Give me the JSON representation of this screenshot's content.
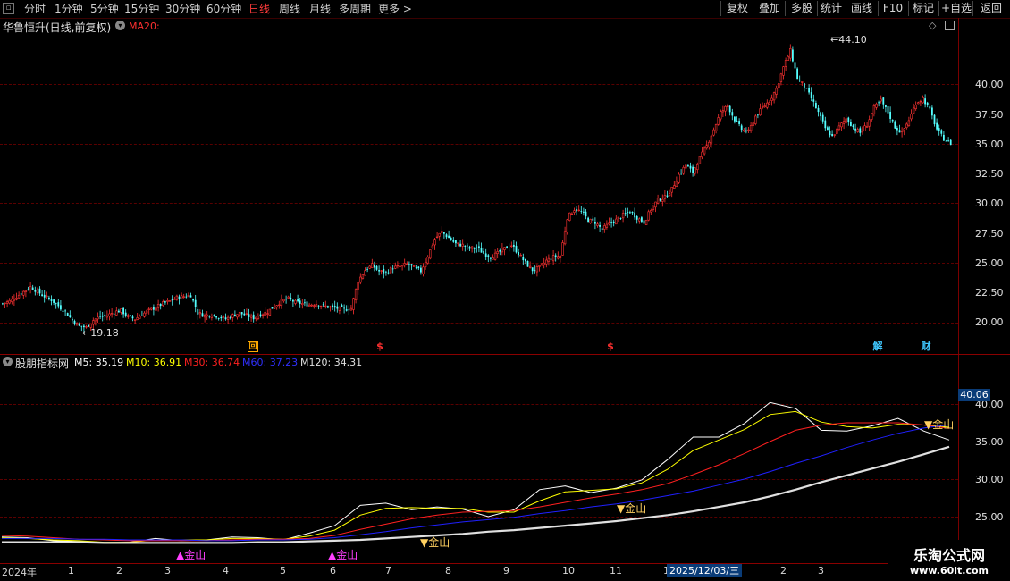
{
  "toolbar": {
    "items": [
      "分时",
      "1分钟",
      "5分钟",
      "15分钟",
      "30分钟",
      "60分钟",
      "日线",
      "周线",
      "月线",
      "多周期",
      "更多 >"
    ],
    "active_index": 6,
    "right_buttons": [
      "复权",
      "叠加",
      "多股",
      "统计",
      "画线",
      "F10",
      "标记",
      "+自选",
      "返回"
    ]
  },
  "main_panel": {
    "stock_title": "华鲁恒升(日线,前复权)",
    "ma_label": "MA20:",
    "high_label": "44.10",
    "low_label": "19.18",
    "markers": [
      "回",
      "$",
      "$",
      "解",
      "财"
    ],
    "ma_color": "#ff3030"
  },
  "indicator": {
    "name": "股朋指标网",
    "m5": "M5: 35.19",
    "m10": "M10: 36.91",
    "m30": "M30: 36.74",
    "m60": "M60: 37.23",
    "m120": "M120: 34.31",
    "current_value": "40.06",
    "signals": [
      "金山",
      "金山",
      "金山",
      "金山",
      "金山",
      "金山"
    ]
  },
  "axes": {
    "main_prices": [
      "40.00",
      "37.50",
      "35.00",
      "32.50",
      "30.00",
      "27.50",
      "25.00",
      "22.50",
      "20.00"
    ],
    "indicator_prices": [
      "40.00",
      "35.00",
      "30.00",
      "25.00"
    ],
    "x_labels": [
      "2024年",
      "1",
      "2",
      "3",
      "4",
      "5",
      "6",
      "7",
      "8",
      "9",
      "10",
      "11",
      "1",
      "2",
      "3"
    ],
    "cursor_date": "2025/12/03/三"
  },
  "watermark": {
    "title": "乐淘公式网",
    "url": "www.60lt.com"
  },
  "chart_data": {
    "type": "candlestick",
    "title": "",
    "ylim": [
      18,
      45
    ],
    "high": 44.1,
    "low": 19.18,
    "close_path": [
      [
        0,
        21.6
      ],
      [
        3,
        21.8
      ],
      [
        6,
        22.2
      ],
      [
        9,
        22.6
      ],
      [
        12,
        23.0
      ],
      [
        15,
        22.6
      ],
      [
        18,
        22.2
      ],
      [
        21,
        21.9
      ],
      [
        24,
        21.4
      ],
      [
        27,
        20.9
      ],
      [
        30,
        20.2
      ],
      [
        33,
        19.7
      ],
      [
        36,
        19.6
      ],
      [
        39,
        20.2
      ],
      [
        42,
        20.5
      ],
      [
        45,
        20.6
      ],
      [
        48,
        20.9
      ],
      [
        51,
        21.0
      ],
      [
        54,
        20.5
      ],
      [
        57,
        20.3
      ],
      [
        60,
        20.7
      ],
      [
        63,
        21.0
      ],
      [
        66,
        21.3
      ],
      [
        69,
        21.6
      ],
      [
        72,
        21.8
      ],
      [
        75,
        22.1
      ],
      [
        78,
        22.2
      ],
      [
        81,
        22.3
      ],
      [
        84,
        20.8
      ],
      [
        87,
        20.6
      ],
      [
        90,
        20.7
      ],
      [
        93,
        20.5
      ],
      [
        96,
        20.3
      ],
      [
        99,
        20.6
      ],
      [
        102,
        20.8
      ],
      [
        105,
        20.6
      ],
      [
        108,
        20.4
      ],
      [
        111,
        20.7
      ],
      [
        114,
        20.9
      ],
      [
        117,
        21.4
      ],
      [
        120,
        21.8
      ],
      [
        123,
        22.0
      ],
      [
        126,
        21.7
      ],
      [
        129,
        21.6
      ],
      [
        132,
        21.5
      ],
      [
        135,
        21.6
      ],
      [
        138,
        21.4
      ],
      [
        141,
        21.3
      ],
      [
        144,
        21.2
      ],
      [
        147,
        21.1
      ],
      [
        150,
        21.2
      ],
      [
        153,
        23.5
      ],
      [
        156,
        24.4
      ],
      [
        159,
        24.8
      ],
      [
        162,
        24.3
      ],
      [
        165,
        24.2
      ],
      [
        168,
        24.6
      ],
      [
        171,
        24.7
      ],
      [
        174,
        24.9
      ],
      [
        177,
        24.6
      ],
      [
        180,
        24.3
      ],
      [
        183,
        25.6
      ],
      [
        186,
        27.0
      ],
      [
        189,
        27.6
      ],
      [
        192,
        27.1
      ],
      [
        195,
        26.6
      ],
      [
        198,
        26.5
      ],
      [
        201,
        26.2
      ],
      [
        204,
        26.3
      ],
      [
        207,
        25.8
      ],
      [
        210,
        25.5
      ],
      [
        213,
        25.8
      ],
      [
        216,
        26.2
      ],
      [
        219,
        26.5
      ],
      [
        222,
        25.8
      ],
      [
        225,
        25.0
      ],
      [
        228,
        24.4
      ],
      [
        231,
        24.6
      ],
      [
        234,
        25.2
      ],
      [
        237,
        25.5
      ],
      [
        240,
        25.6
      ],
      [
        243,
        28.8
      ],
      [
        246,
        29.5
      ],
      [
        249,
        29.3
      ],
      [
        252,
        28.6
      ],
      [
        255,
        28.4
      ],
      [
        258,
        27.8
      ],
      [
        261,
        28.3
      ],
      [
        264,
        28.6
      ],
      [
        267,
        29.0
      ],
      [
        270,
        29.3
      ],
      [
        273,
        28.8
      ],
      [
        276,
        28.4
      ],
      [
        279,
        29.5
      ],
      [
        282,
        30.3
      ],
      [
        285,
        30.5
      ],
      [
        288,
        31.2
      ],
      [
        291,
        32.4
      ],
      [
        294,
        33.2
      ],
      [
        297,
        32.6
      ],
      [
        300,
        33.8
      ],
      [
        303,
        34.8
      ],
      [
        306,
        36.2
      ],
      [
        309,
        37.6
      ],
      [
        312,
        38.2
      ],
      [
        315,
        37.0
      ],
      [
        318,
        36.2
      ],
      [
        321,
        36.0
      ],
      [
        324,
        37.3
      ],
      [
        327,
        38.0
      ],
      [
        330,
        38.6
      ],
      [
        333,
        39.6
      ],
      [
        336,
        41.4
      ],
      [
        339,
        42.8
      ],
      [
        342,
        40.5
      ],
      [
        345,
        39.8
      ],
      [
        348,
        38.8
      ],
      [
        351,
        37.6
      ],
      [
        354,
        36.3
      ],
      [
        357,
        35.6
      ],
      [
        360,
        36.4
      ],
      [
        363,
        37.1
      ],
      [
        366,
        36.4
      ],
      [
        369,
        35.9
      ],
      [
        372,
        36.6
      ],
      [
        375,
        38.0
      ],
      [
        378,
        38.6
      ],
      [
        381,
        37.6
      ],
      [
        384,
        36.4
      ],
      [
        387,
        35.9
      ],
      [
        390,
        37.0
      ],
      [
        393,
        38.4
      ],
      [
        396,
        38.8
      ],
      [
        399,
        37.8
      ],
      [
        402,
        36.2
      ],
      [
        405,
        35.4
      ],
      [
        408,
        35.0
      ]
    ],
    "indicator_ylim": [
      21,
      41
    ],
    "indicator_series": [
      {
        "name": "M5",
        "color": "#ffffff",
        "values": [
          22.3,
          22.2,
          21.8,
          21.7,
          21.5,
          21.6,
          22.1,
          21.8,
          21.9,
          22.3,
          22.2,
          21.9,
          22.8,
          23.8,
          26.5,
          26.8,
          25.9,
          26.3,
          26.0,
          25.0,
          25.9,
          28.6,
          29.1,
          28.2,
          28.8,
          29.9,
          32.6,
          35.6,
          35.6,
          37.4,
          40.2,
          39.4,
          36.5,
          36.4,
          37.1,
          38.1,
          36.4,
          35.2
        ]
      },
      {
        "name": "M10",
        "color": "#ffff00",
        "values": [
          22.2,
          22.1,
          21.9,
          21.8,
          21.6,
          21.6,
          21.9,
          21.9,
          21.9,
          22.1,
          22.1,
          22.0,
          22.4,
          23.2,
          25.2,
          26.1,
          26.2,
          26.1,
          26.1,
          25.6,
          25.6,
          27.1,
          28.3,
          28.5,
          28.7,
          29.5,
          31.3,
          33.8,
          35.2,
          36.6,
          38.6,
          39.0,
          37.6,
          37.0,
          36.8,
          37.3,
          37.2,
          36.9
        ]
      },
      {
        "name": "M30",
        "color": "#ff2020",
        "values": [
          22.5,
          22.4,
          22.2,
          22.0,
          21.9,
          21.8,
          21.8,
          21.8,
          21.8,
          21.9,
          22.0,
          22.0,
          22.1,
          22.5,
          23.3,
          24.0,
          24.7,
          25.2,
          25.6,
          25.7,
          25.8,
          26.3,
          26.9,
          27.5,
          28.0,
          28.6,
          29.4,
          30.6,
          31.9,
          33.4,
          35.0,
          36.5,
          37.2,
          37.5,
          37.5,
          37.5,
          37.2,
          36.74
        ]
      },
      {
        "name": "M60",
        "color": "#2020ff",
        "values": [
          22.1,
          22.1,
          22.1,
          22.0,
          22.0,
          21.9,
          21.9,
          21.9,
          21.8,
          21.8,
          21.9,
          21.9,
          22.0,
          22.2,
          22.6,
          23.0,
          23.5,
          23.9,
          24.3,
          24.6,
          24.9,
          25.4,
          25.8,
          26.3,
          26.7,
          27.2,
          27.8,
          28.4,
          29.2,
          30.0,
          31.0,
          32.1,
          33.1,
          34.2,
          35.2,
          36.1,
          36.8,
          37.23
        ]
      },
      {
        "name": "M120",
        "color": "#e0e0e0",
        "values": [
          21.6,
          21.6,
          21.6,
          21.6,
          21.5,
          21.5,
          21.5,
          21.5,
          21.5,
          21.5,
          21.6,
          21.6,
          21.7,
          21.8,
          21.9,
          22.1,
          22.3,
          22.5,
          22.7,
          23.0,
          23.2,
          23.5,
          23.8,
          24.1,
          24.4,
          24.8,
          25.2,
          25.7,
          26.3,
          26.9,
          27.7,
          28.6,
          29.6,
          30.5,
          31.4,
          32.3,
          33.3,
          34.31
        ]
      }
    ]
  }
}
